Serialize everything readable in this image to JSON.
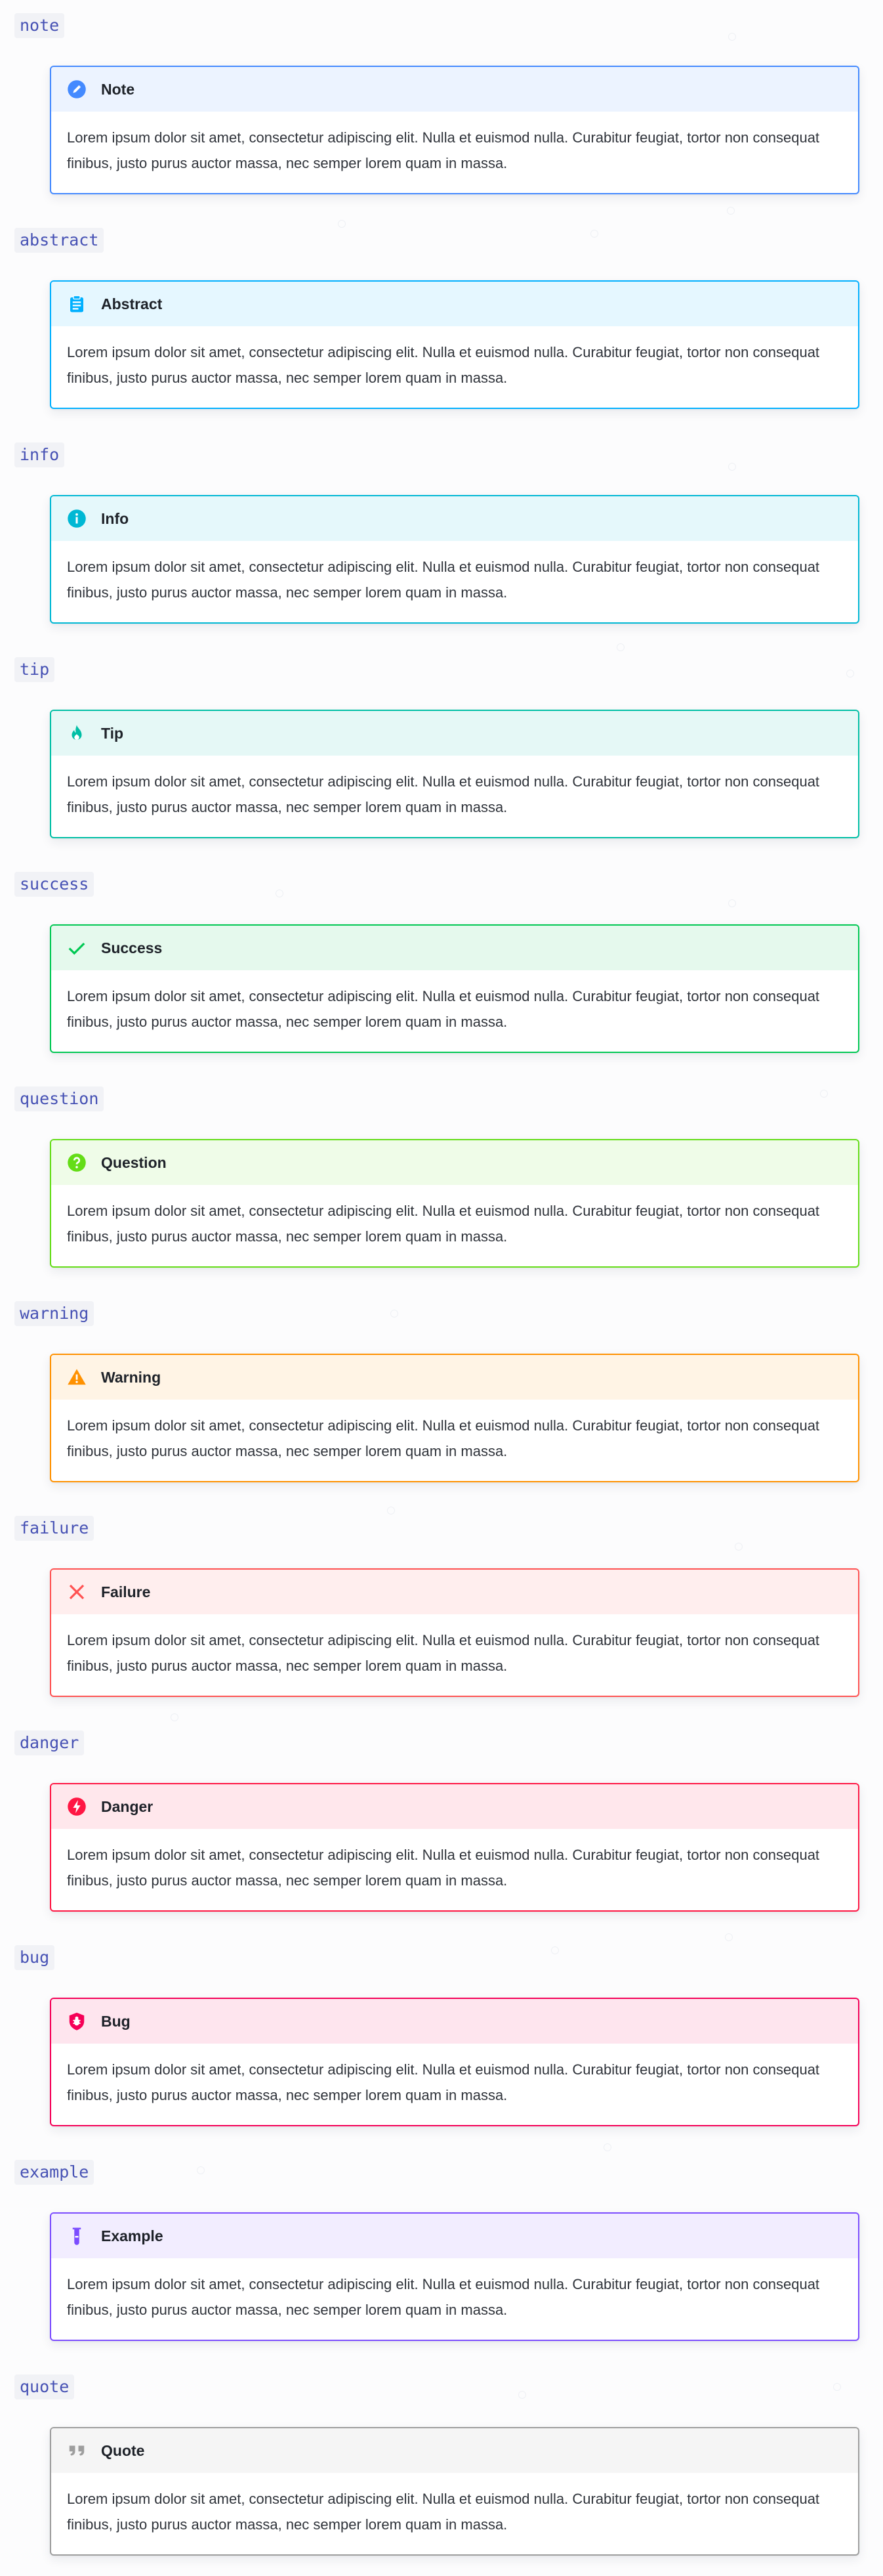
{
  "body_text": "Lorem ipsum dolor sit amet, consectetur adipiscing elit. Nulla et euismod nulla. Curabitur feugiat, tortor non consequat finibus, justo purus auctor massa, nec semper lorem quam in massa.",
  "sections": [
    {
      "label": "note",
      "title": "Note",
      "icon": "pencil-icon",
      "border": "#448aff",
      "header_bg": "#ecf3ff",
      "icon_color": "#448aff"
    },
    {
      "label": "abstract",
      "title": "Abstract",
      "icon": "clipboard-icon",
      "border": "#00b0ff",
      "header_bg": "#e5f7ff",
      "icon_color": "#00b0ff"
    },
    {
      "label": "info",
      "title": "Info",
      "icon": "info-icon",
      "border": "#00b8d4",
      "header_bg": "#e5f8fb",
      "icon_color": "#00b8d4"
    },
    {
      "label": "tip",
      "title": "Tip",
      "icon": "flame-icon",
      "border": "#00bfa5",
      "header_bg": "#e5f8f6",
      "icon_color": "#00bfa5"
    },
    {
      "label": "success",
      "title": "Success",
      "icon": "check-icon",
      "border": "#00c853",
      "header_bg": "#e5f9ed",
      "icon_color": "#00c853"
    },
    {
      "label": "question",
      "title": "Question",
      "icon": "help-icon",
      "border": "#64dd17",
      "header_bg": "#effce8",
      "icon_color": "#64dd17"
    },
    {
      "label": "warning",
      "title": "Warning",
      "icon": "alert-icon",
      "border": "#ff9100",
      "header_bg": "#fff4e5",
      "icon_color": "#ff9100"
    },
    {
      "label": "failure",
      "title": "Failure",
      "icon": "x-icon",
      "border": "#ff5252",
      "header_bg": "#ffeeee",
      "icon_color": "#ff5252"
    },
    {
      "label": "danger",
      "title": "Danger",
      "icon": "lightning-icon",
      "border": "#ff1744",
      "header_bg": "#ffe7ec",
      "icon_color": "#ff1744"
    },
    {
      "label": "bug",
      "title": "Bug",
      "icon": "bug-icon",
      "border": "#f50057",
      "header_bg": "#fee5ee",
      "icon_color": "#f50057"
    },
    {
      "label": "example",
      "title": "Example",
      "icon": "flask-icon",
      "border": "#7c4dff",
      "header_bg": "#f2edff",
      "icon_color": "#7c4dff"
    },
    {
      "label": "quote",
      "title": "Quote",
      "icon": "quote-icon",
      "border": "#9e9e9e",
      "header_bg": "#f5f5f5",
      "icon_color": "#9e9e9e"
    }
  ]
}
